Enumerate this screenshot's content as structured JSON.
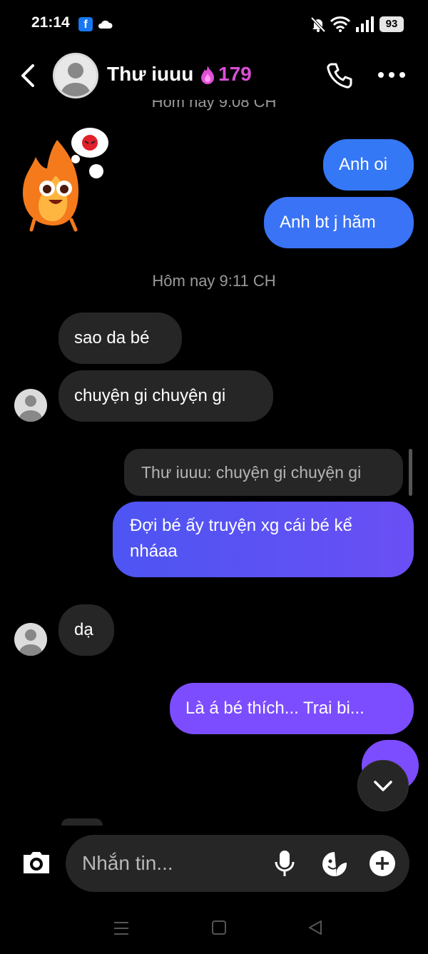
{
  "status_bar": {
    "time": "21:14",
    "battery": "93"
  },
  "header": {
    "contact_name": "Thư iuuu",
    "streak_count": "179"
  },
  "messages": {
    "truncated_timestamp": "Hôm nay 9:08 CH",
    "sent_1": "Anh oi",
    "sent_2": "Anh bt j hăm",
    "timestamp": "Hôm nay 9:11 CH",
    "recv_1": "sao da bé",
    "recv_2": "chuyện gi chuyện gi",
    "reply_quote": "Thư iuuu: chuyện gi chuyện gi",
    "sent_3_line1": "Đợi bé ấy truyện xg cái bé kể",
    "sent_3_line2": "nháaa",
    "recv_3": "dạ",
    "sent_4": "Là á bé thích... Trai bi..."
  },
  "composer": {
    "placeholder": "Nhắn tin..."
  },
  "colors": {
    "sent_blue": "#3478f6",
    "sent_indigo": "#4f5bf0",
    "sent_purple": "#7c4dff",
    "streak_pink": "#d94fd6"
  }
}
